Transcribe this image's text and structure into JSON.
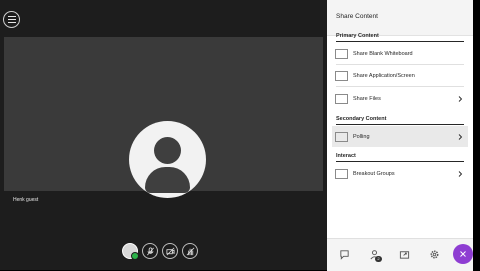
{
  "stage": {
    "guest_name": "Henk guest"
  },
  "panel": {
    "title": "Share Content",
    "sections": [
      {
        "title": "Primary Content",
        "items": [
          {
            "label": "Share Blank Whiteboard",
            "icon": "whiteboard-icon",
            "chevron": false
          },
          {
            "label": "Share Application/Screen",
            "icon": "screen-share-icon",
            "chevron": false
          },
          {
            "label": "Share Files",
            "icon": "files-icon",
            "chevron": true
          }
        ]
      },
      {
        "title": "Secondary Content",
        "items": [
          {
            "label": "Polling",
            "icon": "polling-icon",
            "chevron": true
          }
        ]
      },
      {
        "title": "Interact",
        "items": [
          {
            "label": "Breakout Groups",
            "icon": "breakout-groups-icon",
            "chevron": true
          }
        ]
      }
    ],
    "footer": {
      "badge_count": "2"
    }
  },
  "colors": {
    "stage_bg": "#1d1d1d",
    "video_bg": "#3a3a3a",
    "collab_accent": "#8e3dd2",
    "presence_green": "#2db34a"
  }
}
